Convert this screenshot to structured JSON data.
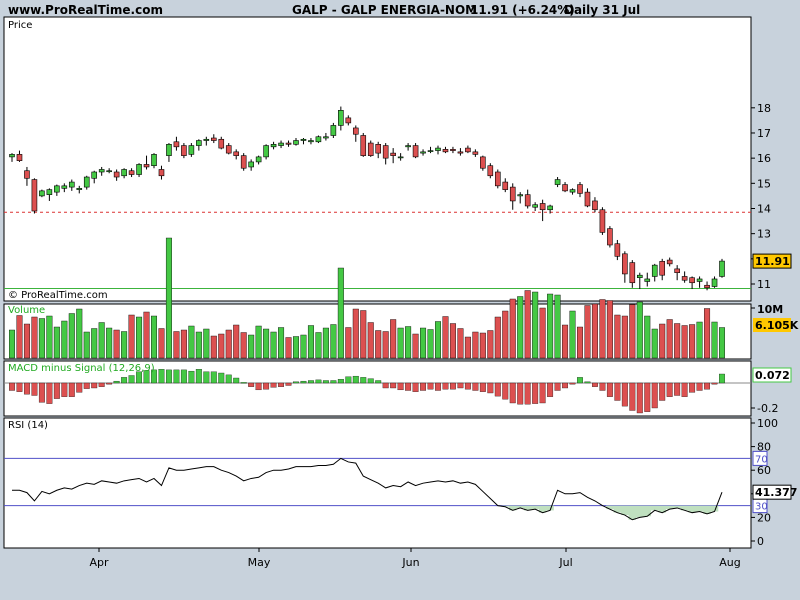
{
  "header": {
    "site": "www.ProRealTime.com",
    "symbol": "GALP - GALP ENERGIA-NOM",
    "last_change": "11.91 (+6.24%)",
    "period": "Daily  31 Jul"
  },
  "colors": {
    "background": "#c8d2dc",
    "panel": "#ffffff",
    "up": "#44c844",
    "down": "#dc5050",
    "resistance": "#dc3232",
    "support": "#3cb43c",
    "tag_price": "#ffc800"
  },
  "chart_data": [
    {
      "type": "candlestick",
      "title": "Price",
      "watermark": "© ProRealTime.com",
      "y_ticks": [
        11,
        12,
        13,
        14,
        15,
        16,
        17,
        18
      ],
      "ylim": [
        10.6,
        18.4
      ],
      "last_value_label": "11.91",
      "reference_lines": [
        13.85,
        10.82
      ],
      "grid": false,
      "ohlc": [
        [
          16.05,
          16.2,
          15.85,
          16.15
        ],
        [
          16.15,
          16.3,
          15.85,
          15.9
        ],
        [
          15.5,
          15.65,
          14.9,
          15.2
        ],
        [
          15.15,
          15.2,
          13.8,
          13.9
        ],
        [
          14.5,
          14.75,
          14.45,
          14.7
        ],
        [
          14.55,
          14.8,
          14.3,
          14.75
        ],
        [
          14.65,
          14.95,
          14.5,
          14.9
        ],
        [
          14.8,
          15.0,
          14.65,
          14.9
        ],
        [
          14.85,
          15.15,
          14.7,
          15.05
        ],
        [
          14.75,
          14.9,
          14.6,
          14.8
        ],
        [
          14.85,
          15.3,
          14.75,
          15.25
        ],
        [
          15.2,
          15.5,
          15.0,
          15.45
        ],
        [
          15.45,
          15.65,
          15.3,
          15.55
        ],
        [
          15.5,
          15.6,
          15.4,
          15.5
        ],
        [
          15.45,
          15.55,
          15.1,
          15.25
        ],
        [
          15.3,
          15.6,
          15.2,
          15.55
        ],
        [
          15.5,
          15.6,
          15.25,
          15.35
        ],
        [
          15.35,
          15.8,
          15.25,
          15.75
        ],
        [
          15.75,
          16.1,
          15.55,
          15.65
        ],
        [
          15.7,
          16.2,
          15.6,
          16.15
        ],
        [
          15.55,
          15.7,
          15.15,
          15.3
        ],
        [
          16.1,
          16.6,
          15.85,
          16.55
        ],
        [
          16.65,
          16.85,
          16.3,
          16.45
        ],
        [
          16.5,
          16.6,
          16.0,
          16.1
        ],
        [
          16.15,
          16.6,
          16.05,
          16.5
        ],
        [
          16.5,
          16.75,
          16.3,
          16.7
        ],
        [
          16.7,
          16.85,
          16.5,
          16.75
        ],
        [
          16.8,
          16.95,
          16.6,
          16.7
        ],
        [
          16.75,
          16.85,
          16.35,
          16.4
        ],
        [
          16.5,
          16.6,
          16.15,
          16.2
        ],
        [
          16.25,
          16.35,
          15.95,
          16.1
        ],
        [
          16.1,
          16.2,
          15.5,
          15.6
        ],
        [
          15.65,
          15.95,
          15.5,
          15.85
        ],
        [
          15.85,
          16.1,
          15.75,
          16.05
        ],
        [
          16.05,
          16.55,
          15.95,
          16.5
        ],
        [
          16.45,
          16.65,
          16.35,
          16.55
        ],
        [
          16.5,
          16.7,
          16.4,
          16.6
        ],
        [
          16.6,
          16.7,
          16.45,
          16.55
        ],
        [
          16.55,
          16.8,
          16.5,
          16.7
        ],
        [
          16.7,
          16.8,
          16.55,
          16.75
        ],
        [
          16.65,
          16.8,
          16.55,
          16.7
        ],
        [
          16.65,
          16.9,
          16.6,
          16.85
        ],
        [
          16.8,
          17.0,
          16.7,
          16.85
        ],
        [
          16.9,
          17.4,
          16.8,
          17.3
        ],
        [
          17.3,
          18.05,
          17.1,
          17.9
        ],
        [
          17.6,
          17.7,
          17.3,
          17.4
        ],
        [
          17.2,
          17.3,
          16.65,
          16.95
        ],
        [
          16.9,
          17.0,
          16.05,
          16.1
        ],
        [
          16.6,
          16.7,
          16.05,
          16.1
        ],
        [
          16.55,
          16.65,
          16.0,
          16.2
        ],
        [
          16.5,
          16.6,
          15.75,
          16.0
        ],
        [
          16.2,
          16.4,
          15.8,
          16.1
        ],
        [
          16.05,
          16.2,
          15.9,
          16.05
        ],
        [
          16.45,
          16.6,
          16.3,
          16.5
        ],
        [
          16.5,
          16.6,
          16.0,
          16.05
        ],
        [
          16.2,
          16.35,
          16.1,
          16.25
        ],
        [
          16.3,
          16.45,
          16.2,
          16.3
        ],
        [
          16.3,
          16.5,
          16.15,
          16.4
        ],
        [
          16.35,
          16.45,
          16.2,
          16.25
        ],
        [
          16.35,
          16.45,
          16.2,
          16.3
        ],
        [
          16.25,
          16.4,
          16.1,
          16.2
        ],
        [
          16.4,
          16.5,
          16.2,
          16.25
        ],
        [
          16.25,
          16.35,
          16.05,
          16.15
        ],
        [
          16.05,
          16.1,
          15.5,
          15.6
        ],
        [
          15.7,
          15.8,
          15.2,
          15.3
        ],
        [
          15.45,
          15.55,
          14.8,
          14.9
        ],
        [
          15.05,
          15.2,
          14.65,
          14.75
        ],
        [
          14.85,
          15.0,
          13.95,
          14.3
        ],
        [
          14.5,
          14.65,
          14.2,
          14.55
        ],
        [
          14.55,
          14.75,
          14.0,
          14.1
        ],
        [
          14.05,
          14.25,
          13.9,
          14.15
        ],
        [
          14.2,
          14.35,
          13.5,
          13.95
        ],
        [
          13.95,
          14.15,
          13.8,
          14.1
        ],
        [
          14.95,
          15.25,
          14.85,
          15.15
        ],
        [
          14.95,
          15.05,
          14.65,
          14.7
        ],
        [
          14.65,
          14.8,
          14.55,
          14.75
        ],
        [
          14.95,
          15.05,
          14.45,
          14.6
        ],
        [
          14.65,
          14.8,
          14.05,
          14.1
        ],
        [
          14.3,
          14.45,
          13.85,
          13.95
        ],
        [
          13.95,
          14.05,
          12.95,
          13.05
        ],
        [
          13.2,
          13.3,
          12.45,
          12.55
        ],
        [
          12.6,
          12.75,
          11.95,
          12.1
        ],
        [
          12.2,
          12.3,
          11.05,
          11.4
        ],
        [
          11.85,
          11.95,
          10.85,
          11.05
        ],
        [
          11.25,
          11.45,
          10.8,
          11.35
        ],
        [
          11.1,
          11.45,
          10.9,
          11.2
        ],
        [
          11.3,
          11.8,
          11.1,
          11.75
        ],
        [
          11.9,
          12.0,
          11.15,
          11.35
        ],
        [
          11.95,
          12.05,
          11.7,
          11.8
        ],
        [
          11.6,
          11.75,
          11.15,
          11.45
        ],
        [
          11.3,
          11.5,
          11.05,
          11.15
        ],
        [
          11.25,
          11.3,
          10.8,
          11.05
        ],
        [
          11.1,
          11.3,
          10.85,
          11.2
        ],
        [
          10.95,
          11.1,
          10.75,
          10.85
        ],
        [
          10.9,
          11.3,
          10.85,
          11.2
        ],
        [
          11.3,
          12.0,
          11.25,
          11.91
        ]
      ]
    },
    {
      "type": "bar",
      "title": "Volume",
      "y_ticks": [
        "10M"
      ],
      "last_value_label": "6.105K",
      "values": [
        5.6,
        8.5,
        6.8,
        8.2,
        7.9,
        8.4,
        6.2,
        7.4,
        8.9,
        9.8,
        5.2,
        5.9,
        7.1,
        6.0,
        5.6,
        5.3,
        8.6,
        8.2,
        9.2,
        8.4,
        5.9,
        24.0,
        5.3,
        5.6,
        6.4,
        5.2,
        5.8,
        4.4,
        4.8,
        5.6,
        6.6,
        5.1,
        4.6,
        6.4,
        5.8,
        5.2,
        6.1,
        4.1,
        4.3,
        4.6,
        6.5,
        5.1,
        6.0,
        6.7,
        18.0,
        6.1,
        9.8,
        9.5,
        7.1,
        5.5,
        5.3,
        7.7,
        6.0,
        6.3,
        4.8,
        6.0,
        5.7,
        7.3,
        8.3,
        6.9,
        5.9,
        4.2,
        5.2,
        5.0,
        5.5,
        8.2,
        9.4,
        11.8,
        12.3,
        13.5,
        13.2,
        10.0,
        12.8,
        12.6,
        6.6,
        9.4,
        6.2,
        10.5,
        10.8,
        11.7,
        11.5,
        8.6,
        8.4,
        10.7,
        11.2,
        8.4,
        5.8,
        6.8,
        7.7,
        6.9,
        6.5,
        6.7,
        7.2,
        9.9,
        7.2,
        6.1
      ]
    },
    {
      "type": "bar",
      "title": "MACD minus Signal (12,26,9)",
      "y_ticks": [
        -0.2
      ],
      "last_value_label": "0.072",
      "values": [
        -0.06,
        -0.07,
        -0.09,
        -0.1,
        -0.155,
        -0.165,
        -0.125,
        -0.11,
        -0.11,
        -0.075,
        -0.045,
        -0.04,
        -0.03,
        -0.01,
        0.015,
        0.045,
        0.06,
        0.09,
        0.1,
        0.105,
        0.11,
        0.105,
        0.105,
        0.105,
        0.095,
        0.11,
        0.09,
        0.09,
        0.08,
        0.065,
        0.04,
        0.005,
        -0.03,
        -0.055,
        -0.05,
        -0.035,
        -0.03,
        -0.02,
        0.01,
        0.015,
        0.02,
        0.025,
        0.02,
        0.02,
        0.03,
        0.05,
        0.055,
        0.045,
        0.035,
        0.02,
        -0.04,
        -0.04,
        -0.055,
        -0.06,
        -0.07,
        -0.06,
        -0.05,
        -0.06,
        -0.05,
        -0.05,
        -0.04,
        -0.05,
        -0.06,
        -0.07,
        -0.08,
        -0.105,
        -0.13,
        -0.16,
        -0.17,
        -0.17,
        -0.165,
        -0.16,
        -0.11,
        -0.06,
        -0.04,
        -0.01,
        0.045,
        0.01,
        -0.03,
        -0.06,
        -0.11,
        -0.14,
        -0.185,
        -0.22,
        -0.24,
        -0.23,
        -0.2,
        -0.14,
        -0.11,
        -0.1,
        -0.11,
        -0.075,
        -0.06,
        -0.05,
        -0.01,
        0.072
      ]
    },
    {
      "type": "line",
      "title": "RSI (14)",
      "y_ticks": [
        0,
        20,
        40,
        60,
        80,
        100
      ],
      "ylim": [
        0,
        100
      ],
      "reference_lines": [
        30,
        70
      ],
      "reference_labels": [
        "30",
        "70"
      ],
      "last_value_label": "41.377",
      "values": [
        43,
        43,
        41,
        34,
        42,
        40,
        43,
        45,
        44,
        47,
        49,
        48,
        51,
        50,
        49,
        51,
        52,
        53,
        50,
        53,
        47,
        62,
        60,
        60,
        61,
        62,
        63,
        63,
        60,
        58,
        55,
        51,
        53,
        54,
        58,
        60,
        60,
        61,
        63,
        63,
        63,
        64,
        64,
        65,
        70,
        67,
        66,
        55,
        52,
        49,
        45,
        47,
        46,
        50,
        47,
        49,
        50,
        51,
        50,
        51,
        49,
        50,
        48,
        42,
        36,
        30,
        29,
        26,
        28,
        26,
        27,
        24,
        26,
        43,
        40,
        40,
        41,
        37,
        34,
        30,
        27,
        24,
        22,
        18,
        20,
        21,
        26,
        24,
        27,
        28,
        26,
        24,
        25,
        23,
        25,
        41.377
      ]
    }
  ],
  "x_axis": {
    "labels": [
      "Apr",
      "May",
      "Jun",
      "Jul",
      "Aug"
    ]
  }
}
